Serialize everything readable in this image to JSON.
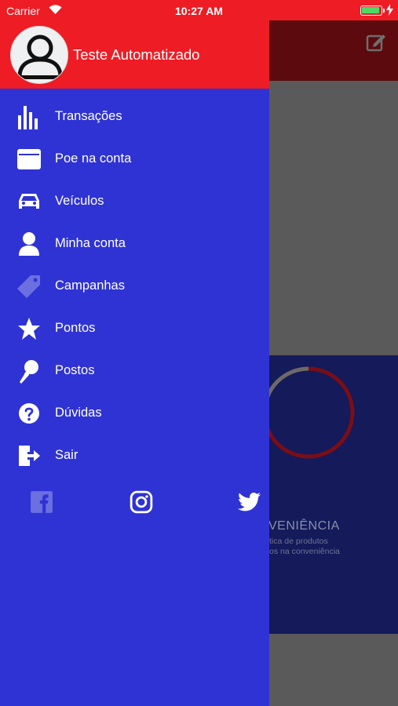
{
  "status_bar": {
    "carrier": "Carrier",
    "time": "10:27 AM",
    "battery_level": 0.95
  },
  "background": {
    "section_title": "VENIÊNCIA",
    "section_sub1": "tica de produtos",
    "section_sub2": "os na conveniência"
  },
  "drawer": {
    "user_name": "Teste Automatizado",
    "menu": [
      {
        "label": "Transações",
        "icon": "bar-chart-icon"
      },
      {
        "label": "Poe na conta",
        "icon": "wallet-icon"
      },
      {
        "label": "Veículos",
        "icon": "car-icon"
      },
      {
        "label": "Minha conta",
        "icon": "user-icon"
      },
      {
        "label": "Campanhas",
        "icon": "tag-icon"
      },
      {
        "label": "Pontos",
        "icon": "star-icon"
      },
      {
        "label": "Postos",
        "icon": "pin-icon"
      },
      {
        "label": "Dúvidas",
        "icon": "question-icon"
      },
      {
        "label": "Sair",
        "icon": "logout-icon"
      }
    ],
    "social": [
      "facebook-icon",
      "instagram-icon",
      "twitter-icon"
    ]
  },
  "colors": {
    "header_red": "#ee1c25",
    "drawer_blue": "#2f33d4",
    "tag_icon_muted": "#6b6fe0"
  }
}
